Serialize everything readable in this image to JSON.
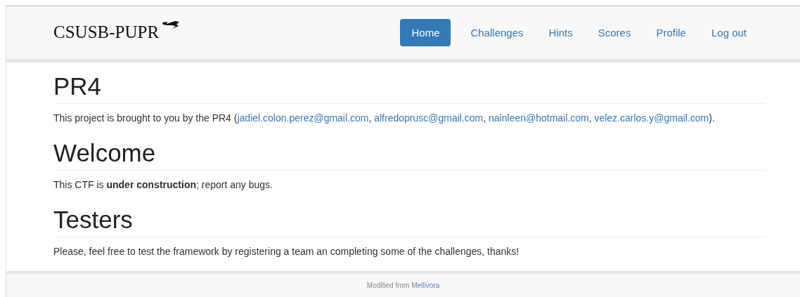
{
  "navbar": {
    "brand": "CSUSB-PUPR",
    "links": [
      {
        "label": "Home",
        "selected": true
      },
      {
        "label": "Challenges",
        "selected": false
      },
      {
        "label": "Hints",
        "selected": false
      },
      {
        "label": "Scores",
        "selected": false
      },
      {
        "label": "Profile",
        "selected": false
      },
      {
        "label": "Log out",
        "selected": false
      }
    ]
  },
  "sections": [
    {
      "heading": "PR4",
      "paragraph": [
        {
          "kind": "text",
          "text": "This project is brought to you by the PR4 ("
        },
        {
          "kind": "link",
          "text": "jadiel.colon.perez@gmail.com"
        },
        {
          "kind": "text",
          "text": ", "
        },
        {
          "kind": "link",
          "text": "alfredoprusc@gmail.com"
        },
        {
          "kind": "text",
          "text": ", "
        },
        {
          "kind": "link",
          "text": "nainleen@hotmail.com"
        },
        {
          "kind": "text",
          "text": ", "
        },
        {
          "kind": "link",
          "text": "velez.carlos.y@gmail.com"
        },
        {
          "kind": "text",
          "text": ")."
        }
      ]
    },
    {
      "heading": "Welcome",
      "paragraph": [
        {
          "kind": "rich",
          "text": "This CTF is **under construction**; report any bugs."
        }
      ]
    },
    {
      "heading": "Testers",
      "paragraph": [
        {
          "kind": "text",
          "text": "Please, feel free to test the framework by registering a team an completing some of the challenges, thanks!"
        }
      ]
    }
  ],
  "footer": [
    {
      "kind": "text",
      "text": "Modified from "
    },
    {
      "kind": "link",
      "text": "Mellivora"
    }
  ]
}
